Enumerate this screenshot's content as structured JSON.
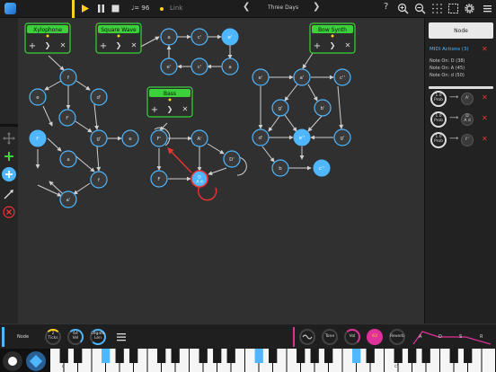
{
  "topbar": {
    "tempo": "♩= 96",
    "link_label": "Link",
    "song_title": "Three Days",
    "help": "?",
    "prev": "❮",
    "next": "❯"
  },
  "colors": {
    "accent": "#4fb7ff",
    "green": "#3ad13a",
    "playhead": "#ffd21f",
    "magenta": "#e0319a",
    "delete": "#e33333"
  },
  "groups": [
    {
      "name": "Xylophone"
    },
    {
      "name": "Square Wave"
    },
    {
      "name": "Bass"
    },
    {
      "name": "Bow Synth"
    }
  ],
  "nodes": {
    "xylophone": [
      "f",
      "e",
      "d'",
      "f'",
      "g'",
      "e",
      "a",
      "f'",
      "f",
      "a'"
    ],
    "square": [
      "a",
      "c'",
      "e'",
      "e'",
      "c'",
      "a"
    ],
    "bass": [
      "F'",
      "A'",
      "D'",
      "F",
      "D\nA d"
    ],
    "bowsynth": [
      "e'",
      "a'",
      "c''",
      "g'",
      "b'",
      "d'",
      "e''",
      "g'",
      "b",
      "c''"
    ]
  },
  "panel": {
    "header": "Node",
    "midi_title": "MIDI Actions (3)",
    "notes": [
      "Note On: D (38)",
      "Note On: A (45)",
      "Note On: d (50)"
    ],
    "edges": [
      {
        "prob_value": "1.0",
        "prob_label": "Prob",
        "target": "A'"
      },
      {
        "prob_value": "1.0",
        "prob_label": "Prob",
        "target": "D\nA d"
      },
      {
        "prob_value": "1.0",
        "prob_label": "Prob",
        "target": "F'"
      }
    ],
    "arrow": "⟶"
  },
  "bottombar": {
    "node_label": "Node",
    "ticks_value": "2",
    "ticks_label": "Ticks",
    "vel_value": "64",
    "vel_label": "Vel",
    "len_value": "Legato",
    "len_label": "Len",
    "tone_label": "Tone",
    "vol_label": "Vol",
    "vol_value": "63",
    "reverb_label": "Reverb",
    "adsr": [
      "A",
      "D",
      "S",
      "R"
    ]
  },
  "keyboard": {
    "labels": [
      "c",
      "c'"
    ]
  }
}
